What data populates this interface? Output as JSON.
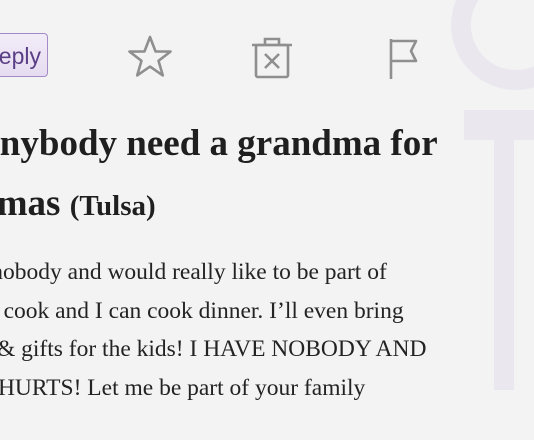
{
  "toolbar": {
    "reply_label": "reply",
    "icons": [
      "star-icon",
      "trash-icon",
      "flag-icon"
    ]
  },
  "post": {
    "title_line1": "Does anybody need a grandma for",
    "title_line2_main": "Christmas",
    "location": "(Tulsa)",
    "body_lines": [
      "I am nobody and would really like to be part of",
      "a family. I cook and I can cook dinner. I’ll even bring",
      "food & gifts for the kids! I HAVE NOBODY AND",
      "IT REALLY HURTS! Let me be part of your family"
    ]
  },
  "colors": {
    "accent": "#a48bc7",
    "reply_text": "#5b3f86",
    "icon": "#8f8f8f",
    "text": "#1f1f1f"
  }
}
